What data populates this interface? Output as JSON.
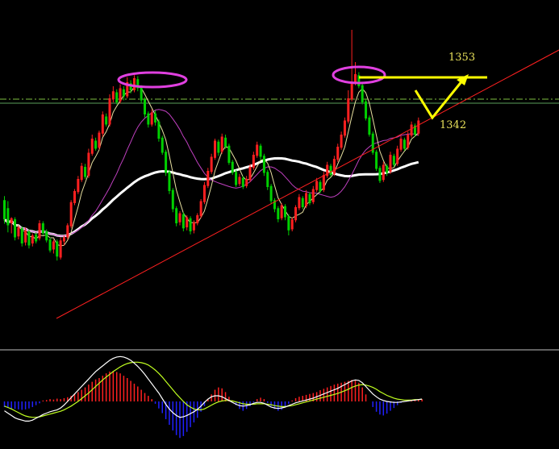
{
  "chart_data": {
    "type": "candlestick",
    "title": "",
    "xlabel": "",
    "ylabel": "",
    "colors": {
      "background": "#000000",
      "up": "#ff2020",
      "down": "#00d000",
      "ma_short": "#e8e0a0",
      "ma_mid": "#c040c0",
      "ma_long": "#ffffff",
      "trendline": "#ff2020",
      "level_line": "#5aa05a",
      "dash_line": "#80c040",
      "ellipse": "#e040e0",
      "annotation": "#ffff00",
      "macd_pos": "#ff2020",
      "macd_neg": "#2020ff",
      "dif": "#ffffff",
      "dea": "#c0ff20",
      "separator": "#c0c0c0"
    },
    "annotations": {
      "target": "1353",
      "support": "1342"
    },
    "price_series": [
      [
        0.55,
        -0.4,
        0.75,
        -0.62
      ],
      [
        0.15,
        -0.7,
        0.5,
        -1.05
      ],
      [
        -0.6,
        -0.35,
        -0.3,
        -1.1
      ],
      [
        -0.4,
        -1.3,
        -0.3,
        -1.45
      ],
      [
        -1.25,
        -0.8,
        -0.7,
        -1.4
      ],
      [
        -0.85,
        -1.6,
        -0.75,
        -1.75
      ],
      [
        -1.55,
        -0.95,
        -0.8,
        -1.7
      ],
      [
        -1.0,
        -1.7,
        -0.9,
        -1.85
      ],
      [
        -1.6,
        -1.2,
        -1.1,
        -1.75
      ],
      [
        -1.15,
        -1.5,
        -1.05,
        -1.6
      ],
      [
        -1.35,
        -0.6,
        -0.45,
        -1.45
      ],
      [
        -0.6,
        -1.1,
        -0.5,
        -1.2
      ],
      [
        -1.0,
        -1.45,
        -0.9,
        -1.55
      ],
      [
        -1.4,
        -1.95,
        -1.3,
        -2.05
      ],
      [
        -1.9,
        -1.5,
        -1.4,
        -2.1
      ],
      [
        -1.5,
        -2.25,
        -1.4,
        -2.45
      ],
      [
        -2.3,
        -1.45,
        -1.3,
        -2.4
      ],
      [
        -1.5,
        -1.3,
        -1.2,
        -1.7
      ],
      [
        -1.3,
        -0.7,
        -0.6,
        -1.4
      ],
      [
        -0.75,
        0.45,
        0.55,
        -0.85
      ],
      [
        0.4,
        1.0,
        1.1,
        0.3
      ],
      [
        0.95,
        1.6,
        1.75,
        0.85
      ],
      [
        1.55,
        2.25,
        2.4,
        1.45
      ],
      [
        2.2,
        1.7,
        2.35,
        1.6
      ],
      [
        1.75,
        2.9,
        3.1,
        1.65
      ],
      [
        2.85,
        3.6,
        3.8,
        2.75
      ],
      [
        3.5,
        3.1,
        3.65,
        3.0
      ],
      [
        3.15,
        3.9,
        4.0,
        3.05
      ],
      [
        3.85,
        4.8,
        4.95,
        3.7
      ],
      [
        4.7,
        4.3,
        4.85,
        4.2
      ],
      [
        4.3,
        5.6,
        5.8,
        4.2
      ],
      [
        5.55,
        5.95,
        6.2,
        5.4
      ],
      [
        5.9,
        5.4,
        6.05,
        5.3
      ],
      [
        5.45,
        6.1,
        6.3,
        5.35
      ],
      [
        6.05,
        5.7,
        6.2,
        5.5
      ],
      [
        5.7,
        6.4,
        6.65,
        5.6
      ],
      [
        6.35,
        6.0,
        6.5,
        5.85
      ],
      [
        6.0,
        6.6,
        6.75,
        5.9
      ],
      [
        6.55,
        6.1,
        6.7,
        5.95
      ],
      [
        6.15,
        5.5,
        6.25,
        5.35
      ],
      [
        5.55,
        4.8,
        5.65,
        4.65
      ],
      [
        4.85,
        4.3,
        4.95,
        4.15
      ],
      [
        4.3,
        4.9,
        5.05,
        4.2
      ],
      [
        4.85,
        4.4,
        5.0,
        4.25
      ],
      [
        4.45,
        3.6,
        4.55,
        3.45
      ],
      [
        3.65,
        2.9,
        3.75,
        2.8
      ],
      [
        2.95,
        1.9,
        3.05,
        1.75
      ],
      [
        1.95,
        1.0,
        2.05,
        0.85
      ],
      [
        1.05,
        0.1,
        1.15,
        -0.05
      ],
      [
        0.15,
        -0.6,
        0.25,
        -0.75
      ],
      [
        -0.55,
        -0.1,
        0.0,
        -0.7
      ],
      [
        -0.15,
        -0.85,
        -0.05,
        -1.0
      ],
      [
        -0.8,
        -0.3,
        -0.2,
        -0.95
      ],
      [
        -0.35,
        -1.0,
        -0.25,
        -1.15
      ],
      [
        -0.95,
        -0.55,
        -0.45,
        -1.1
      ],
      [
        -0.6,
        -0.2,
        -0.1,
        -0.7
      ],
      [
        -0.25,
        0.5,
        0.6,
        -0.35
      ],
      [
        0.45,
        1.3,
        1.45,
        0.35
      ],
      [
        1.25,
        2.0,
        2.15,
        1.15
      ],
      [
        1.95,
        2.7,
        2.85,
        1.85
      ],
      [
        2.65,
        3.5,
        3.6,
        2.55
      ],
      [
        3.45,
        2.9,
        3.55,
        2.75
      ],
      [
        2.95,
        3.7,
        3.85,
        2.85
      ],
      [
        3.65,
        3.2,
        3.8,
        3.1
      ],
      [
        3.25,
        2.4,
        3.35,
        2.3
      ],
      [
        2.45,
        1.9,
        2.55,
        1.8
      ],
      [
        1.95,
        1.3,
        2.05,
        1.2
      ],
      [
        1.35,
        1.7,
        1.85,
        1.25
      ],
      [
        1.65,
        1.2,
        1.75,
        1.1
      ],
      [
        1.25,
        1.6,
        1.75,
        1.15
      ],
      [
        1.55,
        2.2,
        2.35,
        1.45
      ],
      [
        2.15,
        2.8,
        2.95,
        2.05
      ],
      [
        2.75,
        3.3,
        3.45,
        2.65
      ],
      [
        3.25,
        2.7,
        3.35,
        2.55
      ],
      [
        2.75,
        1.9,
        2.85,
        1.75
      ],
      [
        1.95,
        1.2,
        2.05,
        1.05
      ],
      [
        1.25,
        0.5,
        1.35,
        0.35
      ],
      [
        0.55,
        0.1,
        0.65,
        -0.05
      ],
      [
        0.15,
        -0.4,
        0.25,
        -0.55
      ],
      [
        -0.35,
        0.3,
        0.4,
        -0.45
      ],
      [
        0.25,
        -0.3,
        0.35,
        -0.45
      ],
      [
        -0.25,
        -0.95,
        -0.15,
        -1.2
      ],
      [
        -0.9,
        -0.4,
        -0.3,
        -1.0
      ],
      [
        -0.45,
        0.2,
        0.3,
        -0.55
      ],
      [
        0.15,
        0.7,
        0.85,
        0.05
      ],
      [
        0.65,
        0.2,
        0.75,
        0.1
      ],
      [
        0.25,
        0.9,
        1.05,
        0.15
      ],
      [
        0.85,
        0.4,
        0.95,
        0.3
      ],
      [
        0.45,
        1.1,
        1.25,
        0.35
      ],
      [
        1.05,
        1.5,
        1.65,
        0.95
      ],
      [
        1.45,
        1.0,
        1.55,
        0.9
      ],
      [
        1.05,
        1.8,
        1.95,
        0.95
      ],
      [
        1.75,
        2.3,
        2.45,
        1.65
      ],
      [
        2.25,
        1.8,
        2.35,
        1.7
      ],
      [
        1.85,
        2.6,
        2.75,
        1.75
      ],
      [
        2.55,
        3.2,
        3.35,
        2.45
      ],
      [
        3.15,
        3.8,
        3.95,
        3.05
      ],
      [
        3.75,
        4.5,
        4.65,
        3.65
      ],
      [
        4.45,
        5.6,
        6.0,
        4.35
      ],
      [
        5.55,
        6.4,
        9.0,
        5.45
      ],
      [
        6.35,
        6.8,
        7.4,
        6.25
      ],
      [
        6.75,
        6.2,
        6.9,
        6.1
      ],
      [
        6.25,
        5.4,
        6.35,
        5.3
      ],
      [
        5.45,
        4.6,
        5.55,
        4.5
      ],
      [
        4.65,
        3.8,
        4.75,
        3.7
      ],
      [
        3.85,
        2.9,
        3.95,
        2.8
      ],
      [
        2.95,
        2.1,
        3.05,
        2.0
      ],
      [
        2.15,
        1.5,
        2.25,
        1.4
      ],
      [
        1.55,
        2.3,
        2.45,
        1.45
      ],
      [
        2.25,
        1.9,
        2.35,
        1.75
      ],
      [
        1.95,
        2.8,
        2.95,
        1.85
      ],
      [
        2.75,
        2.3,
        2.85,
        2.2
      ],
      [
        2.35,
        3.1,
        3.25,
        2.25
      ],
      [
        3.05,
        3.6,
        3.75,
        2.95
      ],
      [
        3.55,
        3.1,
        3.65,
        3.0
      ],
      [
        3.15,
        3.8,
        3.95,
        3.05
      ],
      [
        3.75,
        4.3,
        4.45,
        3.65
      ],
      [
        4.25,
        3.8,
        4.35,
        3.7
      ],
      [
        3.85,
        4.5,
        4.65,
        3.75
      ]
    ],
    "macd_series": {
      "hist": [
        -0.12,
        -0.14,
        -0.15,
        -0.16,
        -0.17,
        -0.18,
        -0.17,
        -0.15,
        -0.12,
        -0.08,
        -0.04,
        0.02,
        0.03,
        0.05,
        0.04,
        0.06,
        0.05,
        0.07,
        0.09,
        0.12,
        0.16,
        0.2,
        0.25,
        0.3,
        0.36,
        0.42,
        0.47,
        0.5,
        0.55,
        0.6,
        0.64,
        0.65,
        0.63,
        0.6,
        0.55,
        0.5,
        0.44,
        0.38,
        0.32,
        0.25,
        0.18,
        0.12,
        0.05,
        -0.05,
        -0.15,
        -0.25,
        -0.38,
        -0.5,
        -0.62,
        -0.72,
        -0.78,
        -0.74,
        -0.65,
        -0.55,
        -0.45,
        -0.35,
        -0.22,
        -0.1,
        0.05,
        0.15,
        0.25,
        0.3,
        0.28,
        0.2,
        0.1,
        0.02,
        -0.08,
        -0.16,
        -0.2,
        -0.16,
        -0.1,
        -0.02,
        0.05,
        0.08,
        0.05,
        -0.03,
        -0.1,
        -0.16,
        -0.2,
        -0.18,
        -0.12,
        -0.05,
        0.02,
        0.07,
        0.1,
        0.12,
        0.14,
        0.16,
        0.18,
        0.2,
        0.24,
        0.27,
        0.3,
        0.33,
        0.36,
        0.38,
        0.4,
        0.42,
        0.44,
        0.46,
        0.45,
        0.4,
        0.3,
        0.15,
        0.0,
        -0.12,
        -0.22,
        -0.28,
        -0.3,
        -0.26,
        -0.2,
        -0.14,
        -0.08,
        -0.03,
        0.0,
        0.02,
        0.03,
        0.04,
        0.05,
        0.05
      ],
      "dif": [
        -0.2,
        -0.25,
        -0.3,
        -0.35,
        -0.38,
        -0.4,
        -0.42,
        -0.42,
        -0.4,
        -0.36,
        -0.32,
        -0.28,
        -0.25,
        -0.22,
        -0.2,
        -0.18,
        -0.14,
        -0.08,
        0.0,
        0.08,
        0.16,
        0.24,
        0.32,
        0.4,
        0.48,
        0.56,
        0.64,
        0.7,
        0.76,
        0.82,
        0.88,
        0.92,
        0.95,
        0.96,
        0.95,
        0.92,
        0.88,
        0.82,
        0.75,
        0.67,
        0.58,
        0.48,
        0.38,
        0.28,
        0.18,
        0.06,
        -0.06,
        -0.16,
        -0.24,
        -0.3,
        -0.34,
        -0.33,
        -0.3,
        -0.26,
        -0.22,
        -0.17,
        -0.1,
        -0.02,
        0.05,
        0.1,
        0.12,
        0.12,
        0.1,
        0.06,
        0.02,
        -0.02,
        -0.06,
        -0.09,
        -0.1,
        -0.09,
        -0.07,
        -0.04,
        -0.02,
        -0.02,
        -0.04,
        -0.08,
        -0.12,
        -0.14,
        -0.15,
        -0.14,
        -0.12,
        -0.09,
        -0.06,
        -0.03,
        -0.01,
        0.01,
        0.03,
        0.05,
        0.07,
        0.1,
        0.13,
        0.16,
        0.19,
        0.22,
        0.25,
        0.28,
        0.32,
        0.36,
        0.4,
        0.44,
        0.46,
        0.45,
        0.4,
        0.32,
        0.24,
        0.16,
        0.1,
        0.05,
        0.02,
        0.0,
        -0.01,
        -0.02,
        -0.02,
        -0.01,
        0.0,
        0.01,
        0.02,
        0.03,
        0.04,
        0.05
      ],
      "dea": [
        -0.1,
        -0.13,
        -0.16,
        -0.2,
        -0.24,
        -0.28,
        -0.31,
        -0.33,
        -0.34,
        -0.34,
        -0.33,
        -0.31,
        -0.29,
        -0.27,
        -0.25,
        -0.23,
        -0.21,
        -0.18,
        -0.14,
        -0.1,
        -0.05,
        0.0,
        0.06,
        0.12,
        0.18,
        0.25,
        0.32,
        0.39,
        0.46,
        0.52,
        0.58,
        0.64,
        0.69,
        0.74,
        0.78,
        0.81,
        0.83,
        0.84,
        0.84,
        0.83,
        0.81,
        0.78,
        0.73,
        0.67,
        0.6,
        0.52,
        0.43,
        0.34,
        0.25,
        0.16,
        0.08,
        0.0,
        -0.07,
        -0.12,
        -0.16,
        -0.18,
        -0.18,
        -0.16,
        -0.12,
        -0.08,
        -0.04,
        -0.01,
        0.01,
        0.02,
        0.02,
        0.01,
        -0.01,
        -0.03,
        -0.05,
        -0.06,
        -0.06,
        -0.06,
        -0.05,
        -0.05,
        -0.05,
        -0.06,
        -0.07,
        -0.09,
        -0.1,
        -0.11,
        -0.11,
        -0.1,
        -0.09,
        -0.07,
        -0.05,
        -0.03,
        -0.01,
        0.01,
        0.03,
        0.05,
        0.07,
        0.09,
        0.11,
        0.13,
        0.15,
        0.17,
        0.2,
        0.23,
        0.26,
        0.3,
        0.33,
        0.35,
        0.36,
        0.35,
        0.33,
        0.3,
        0.26,
        0.21,
        0.17,
        0.13,
        0.1,
        0.07,
        0.05,
        0.04,
        0.03,
        0.03,
        0.03,
        0.04,
        0.04,
        0.05
      ]
    }
  }
}
